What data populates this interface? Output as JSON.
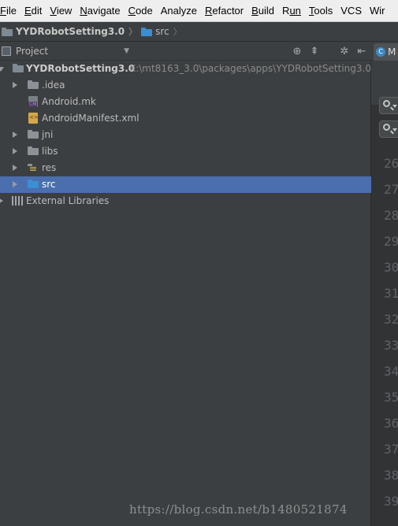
{
  "menubar": {
    "items": [
      {
        "mn": "F",
        "rest": "ile"
      },
      {
        "mn": "E",
        "rest": "dit"
      },
      {
        "mn": "V",
        "rest": "iew"
      },
      {
        "mn": "N",
        "rest": "avigate"
      },
      {
        "mn": "C",
        "rest": "ode"
      },
      {
        "mn": "",
        "rest": "Analyze"
      },
      {
        "mn": "R",
        "rest": "efactor"
      },
      {
        "mn": "B",
        "rest": "uild"
      },
      {
        "mn": "R",
        "rest": "un"
      },
      {
        "mn": "T",
        "rest": "ools"
      },
      {
        "mn": "",
        "rest": "VCS"
      },
      {
        "mn": "",
        "rest": "Wir"
      }
    ]
  },
  "breadcrumb": {
    "project": "YYDRobotSetting3.0",
    "folder": "src"
  },
  "project_panel": {
    "title": "Project",
    "tree": {
      "root": {
        "name": "YYDRobotSetting3.0",
        "path": "X:\\mt8163_3.0\\packages\\apps\\YYDRobotSetting3.0"
      },
      "idea": ".idea",
      "android_mk": "Android.mk",
      "manifest": "AndroidManifest.xml",
      "jni": "jni",
      "libs": "libs",
      "res": "res",
      "src": "src",
      "external": "External Libraries"
    }
  },
  "editor": {
    "tab_letter": "C",
    "tab_label": "M",
    "line_numbers": [
      "26",
      "27",
      "28",
      "29",
      "30",
      "31",
      "32",
      "33",
      "34",
      "35",
      "36",
      "37",
      "38",
      "39"
    ]
  },
  "watermark": "https://blog.csdn.net/b1480521874",
  "colors": {
    "accent_selection": "#4b6eaf",
    "panel_bg": "#3c3f41",
    "editor_bg": "#2b2b2b"
  }
}
